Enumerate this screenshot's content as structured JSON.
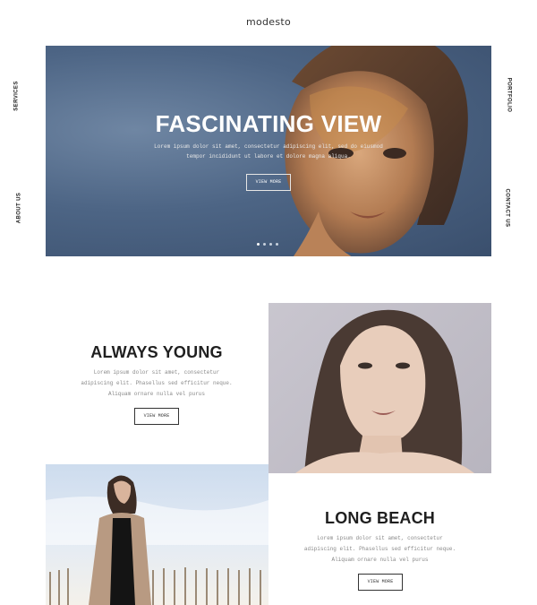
{
  "brand": {
    "logo": "modesto"
  },
  "side_nav": {
    "services": "SERVICES",
    "about": "ABOUT US",
    "portfolio": "PORTFOLIO",
    "contact": "CONTACT US"
  },
  "hero": {
    "title": "FASCINATING VIEW",
    "text_line1": "Lorem ipsum dolor sit amet, consectetur adipiscing elit, sed do eiusmod",
    "text_line2": "tempor incididunt ut labore et dolore magna aliqua.",
    "button": "VIEW MORE",
    "slides_total": 4,
    "active_slide": 1
  },
  "section1": {
    "title": "ALWAYS YOUNG",
    "text_line1": "Lorem ipsum dolor sit amet, consectetur",
    "text_line2": "adipiscing elit. Phasellus sed efficitur neque.",
    "text_line3": "Aliquam ornare nulla vel purus",
    "button": "VIEW MORE"
  },
  "section2": {
    "title": "LONG BEACH",
    "text_line1": "Lorem ipsum dolor sit amet, consectetur",
    "text_line2": "adipiscing elit. Phasellus sed efficitur neque.",
    "text_line3": "Aliquam ornare nulla vel purus",
    "button": "VIEW MORE"
  }
}
